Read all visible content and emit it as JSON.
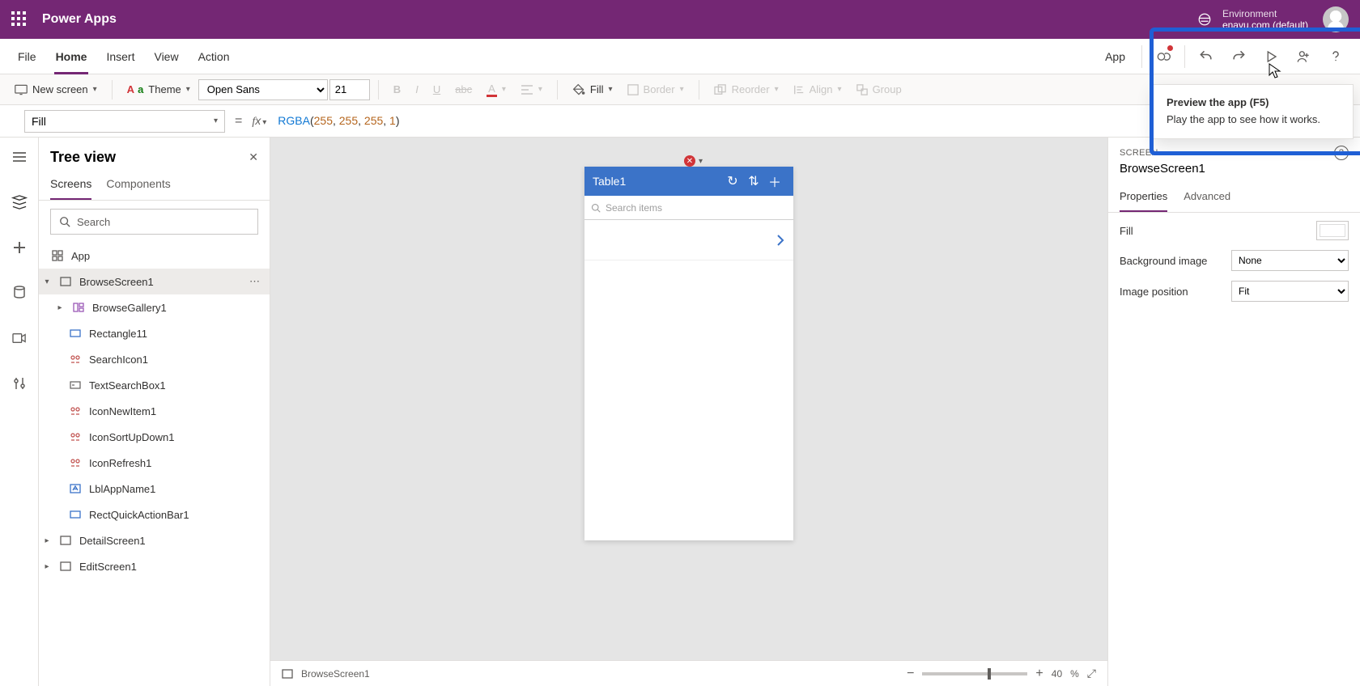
{
  "titlebar": {
    "app_name": "Power Apps",
    "env_label": "Environment",
    "env_value": "enavu.com (default)"
  },
  "menu": {
    "file": "File",
    "home": "Home",
    "insert": "Insert",
    "view": "View",
    "action": "Action",
    "app": "App"
  },
  "tooltip": {
    "title": "Preview the app (F5)",
    "body": "Play the app to see how it works."
  },
  "ribbon": {
    "new_screen": "New screen",
    "theme": "Theme",
    "font": "Open Sans",
    "size": "21",
    "fill": "Fill",
    "border": "Border",
    "reorder": "Reorder",
    "align": "Align",
    "group": "Group"
  },
  "formula": {
    "property": "Fill",
    "fn": "RGBA",
    "args": [
      "255",
      "255",
      "255",
      "1"
    ]
  },
  "tree": {
    "title": "Tree view",
    "tab_screens": "Screens",
    "tab_components": "Components",
    "search_placeholder": "Search",
    "items": {
      "app": "App",
      "browse_screen": "BrowseScreen1",
      "browse_gallery": "BrowseGallery1",
      "rectangle11": "Rectangle11",
      "search_icon": "SearchIcon1",
      "text_search_box": "TextSearchBox1",
      "icon_new_item": "IconNewItem1",
      "icon_sort": "IconSortUpDown1",
      "icon_refresh": "IconRefresh1",
      "lbl_app_name": "LblAppName1",
      "rect_quick": "RectQuickActionBar1",
      "detail_screen": "DetailScreen1",
      "edit_screen": "EditScreen1"
    }
  },
  "phone": {
    "title": "Table1",
    "search_placeholder": "Search items"
  },
  "status": {
    "screen": "BrowseScreen1",
    "zoom": "40",
    "zoom_unit": "%"
  },
  "props": {
    "crumb": "SCREEN",
    "name": "BrowseScreen1",
    "tab_properties": "Properties",
    "tab_advanced": "Advanced",
    "fill_label": "Fill",
    "bg_label": "Background image",
    "bg_value": "None",
    "imgpos_label": "Image position",
    "imgpos_value": "Fit"
  }
}
